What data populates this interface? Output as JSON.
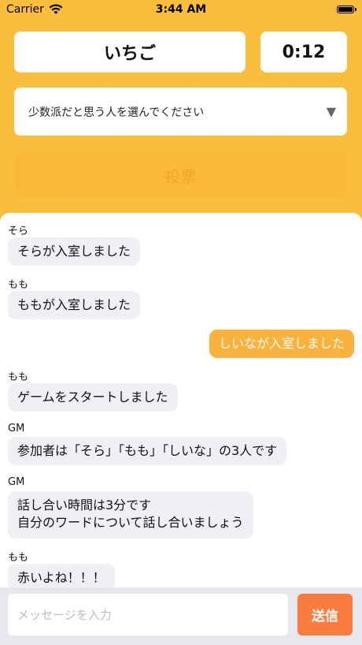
{
  "status_bar": {
    "carrier": "Carrier",
    "time": "3:44 AM",
    "icons": [
      "wifi-icon",
      "battery-icon"
    ]
  },
  "game": {
    "word": "いちご",
    "timer": "0:12"
  },
  "vote": {
    "select_label": "少数派だと思う人を選んでください",
    "dropdown_icon": "▼",
    "button_label": "投票"
  },
  "chat": {
    "messages": [
      {
        "sender": "そら",
        "text": "そらが入室しました",
        "mine": false
      },
      {
        "sender": "もも",
        "text": "ももが入室しました",
        "mine": false
      },
      {
        "sender": "",
        "text": "しいなが入室しました",
        "mine": true
      },
      {
        "sender": "もも",
        "text": "ゲームをスタートしました",
        "mine": false
      },
      {
        "sender": "GM",
        "text": "参加者は「そら」「もも」「しいな」の3人です",
        "mine": false
      },
      {
        "sender": "GM",
        "line1": "話し合い時間は3分です",
        "line2": "自分のワードについて話し合いましょう",
        "mine": false
      },
      {
        "sender": "もも",
        "text": "赤いよね！！！",
        "mine": false
      }
    ]
  },
  "composer": {
    "placeholder": "メッセージを入力",
    "send_label": "送信"
  },
  "colors": {
    "background": "#fbbe3c",
    "my_bubble": "#fbb23c",
    "send_button": "#fa7c3e"
  }
}
